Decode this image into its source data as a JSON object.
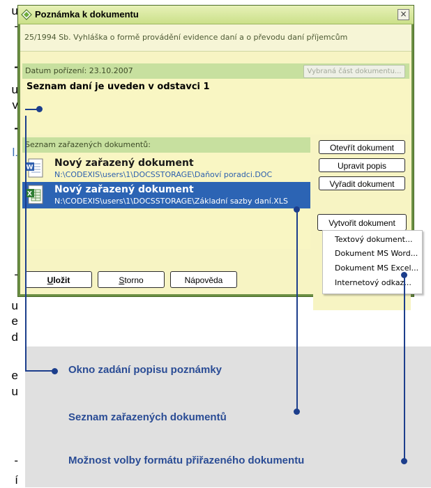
{
  "left_fragments": [
    "u",
    "-",
    "-",
    "u",
    "v",
    "-",
    "l.",
    "-",
    "u",
    "e",
    "d",
    "e",
    "u",
    "-",
    "í"
  ],
  "dialog": {
    "title": "Poznámka k dokumentu",
    "close_glyph": "×",
    "law_text": "25/1994 Sb. Vyhláška o formě provádění evidence daní a o převodu daní příjemcům",
    "date_label": "Datum pořízení: 23.10.2007",
    "selected_part_button": "Vybraná část dokumentu...",
    "note_text": "Seznam daní je uveden v odstavci 1",
    "documents_header": "Seznam zařazených dokumentů:",
    "documents": [
      {
        "name": "Nový zařazený dokument",
        "path": "N:\\CODEXIS\\users\\1\\DOCSSTORAGE\\Daňoví poradci.DOC",
        "type": "word-document-icon",
        "selected": false
      },
      {
        "name": "Nový zařazený dokument",
        "path": "N:\\CODEXIS\\users\\1\\DOCSSTORAGE\\Základní sazby daní.XLS",
        "type": "excel-document-icon",
        "selected": true
      }
    ],
    "buttons": {
      "open": "Otevřít dokument",
      "edit": "Upravit popis",
      "remove": "Vyřadit dokument",
      "create": "Vytvořit dokument",
      "save_first": "U",
      "save_rest": "ložit",
      "cancel_first": "S",
      "cancel_rest": "torno",
      "help": "Nápověda"
    },
    "create_menu": [
      "Textový dokument...",
      "Dokument MS Word...",
      "Dokument MS Excel...",
      "Internetový odkaz..."
    ]
  },
  "annotations": [
    "Okno zadání popisu poznámky",
    "Seznam zařazených dokumentů",
    "Možnost volby formátu přiřazeného dokumentu"
  ],
  "colors": {
    "dialog_frame": "#6b8f43",
    "selection": "#2c64b4",
    "annotation_text": "#2a4c95",
    "annotation_line": "#1c3e8c"
  }
}
